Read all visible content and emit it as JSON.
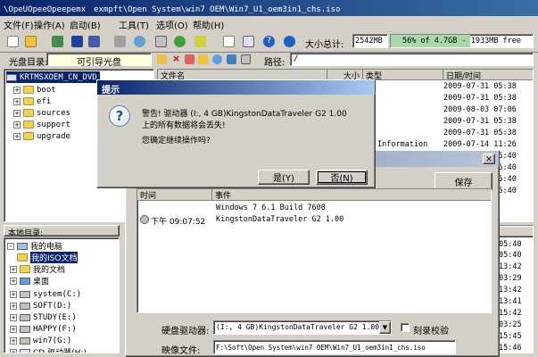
{
  "window": {
    "title": "\\OpeUOpeeOpeepemx　exmpft\\Open System\\win7 OEM\\Win7_U1_oem3in1_chs.iso"
  },
  "menu": {
    "items": [
      "文件(F)",
      "操作(A)",
      "启动(B)",
      "工具(T)",
      "选项(O)",
      "帮助(H)"
    ]
  },
  "toolbar": {
    "total_label": "大小总计:",
    "total_value": "2542MB",
    "usage_text": "56% of 4.7GB - 1933MB free",
    "usage_fraction": 0.56
  },
  "pathbar": {
    "disc_label": "光盘目录:",
    "boot_button": "可引导光盘",
    "path_label": "路径:",
    "path_value": "/"
  },
  "disc_tree": {
    "root": "KRTMSXOEM_CN_DVD",
    "items": [
      "boot",
      "efi",
      "sources",
      "support",
      "upgrade"
    ]
  },
  "file_list": {
    "headers": {
      "name": "文件名",
      "size": "大小",
      "type": "类型",
      "date": "日期/时间"
    },
    "dates": [
      "2009-07-31 05:38",
      "2009-07-31 05:38",
      "2009-08-03 07:06",
      "2009-07-31 05:38",
      "2009-07-31 05:38",
      "2009-07-14 11:26",
      "2009-07-31 05:40",
      "2009-07-31 05:40",
      "2009-07-31 05:40",
      "2009-07-31 05:40"
    ],
    "partial_type": "Information"
  },
  "local_panel": {
    "title": "本地目录:",
    "items": [
      "我的电脑",
      "我的ISO文档",
      "我的文档",
      "桌面",
      "system(C:)",
      "SOFT(D:)",
      "STUDY(E:)",
      "HAPPY(F:)",
      "win7(G:)",
      "CD 驱动器(H:)"
    ],
    "right_times": [
      "05:40",
      "05:40",
      "13:42",
      "03:29",
      "13:42",
      "13:41",
      "15:42",
      "03:25",
      "15:45",
      "15:46"
    ]
  },
  "write_dialog": {
    "save_button": "保存",
    "log_headers": {
      "time": "时间",
      "event": "事件"
    },
    "log_rows": [
      {
        "time": "",
        "event": "Windows 7 6.1 Build 7600"
      },
      {
        "time": "下午 09:07:52",
        "event": "KingstonDataTraveler G2 1.00"
      }
    ],
    "drive_label": "硬盘驱动器:",
    "drive_value": "(I:, 4 GB)KingstonDataTraveler G2 1.00",
    "verify_label": "刻录校验",
    "image_label": "映像文件:",
    "image_value": "F:\\Soft\\Open System\\win7 OEM\\Win7_U1_oem3in1_chs.iso",
    "close_glyph": "×"
  },
  "prompt_dialog": {
    "title": "提示",
    "message_line1": "警告! 驱动器 (I:, 4 GB)KingstonDataTraveler G2 1.00",
    "message_line2": "上的所有数据将会丢失!",
    "question": "您确定继续操作吗?",
    "icon_glyph": "?",
    "yes_button": "是(Y)",
    "no_button": "否(N)"
  }
}
